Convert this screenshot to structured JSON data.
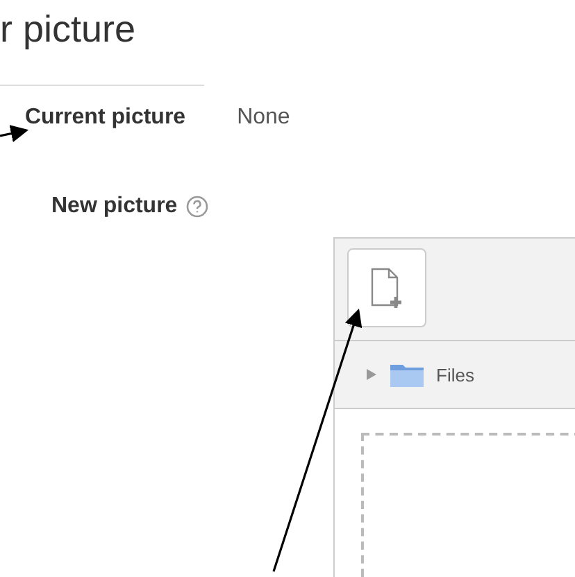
{
  "heading": "r picture",
  "current_picture": {
    "label": "Current picture",
    "value": "None"
  },
  "new_picture": {
    "label": "New picture"
  },
  "file_picker": {
    "folder": "Files"
  }
}
